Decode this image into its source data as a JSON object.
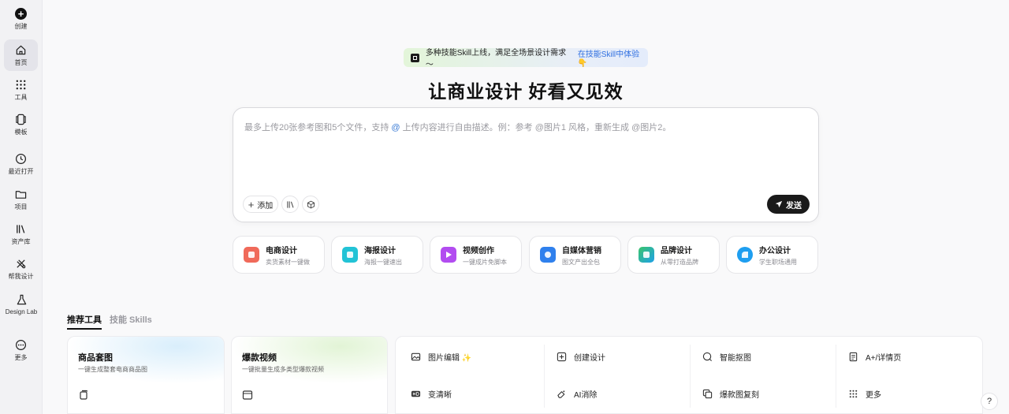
{
  "sidebar": {
    "items": [
      {
        "label": "创建",
        "icon": "create-icon"
      },
      {
        "label": "首页",
        "icon": "home-icon"
      },
      {
        "label": "工具",
        "icon": "grid-icon"
      },
      {
        "label": "模板",
        "icon": "template-icon"
      },
      {
        "label": "最近打开",
        "icon": "clock-icon"
      },
      {
        "label": "项目",
        "icon": "folder-icon"
      },
      {
        "label": "资产库",
        "icon": "library-icon"
      },
      {
        "label": "帮我设计",
        "icon": "design-icon"
      },
      {
        "label": "Design Lab",
        "icon": "flask-icon"
      },
      {
        "label": "更多",
        "icon": "more-icon"
      }
    ]
  },
  "banner": {
    "text": "多种技能Skill上线，满足全场景设计需求～",
    "link": "在技能Skill中体验👇"
  },
  "headline": "让商业设计 好看又见效",
  "prompt": {
    "placeholder_pre": "最多上传20张参考图和5个文件，支持 ",
    "placeholder_at": "@",
    "placeholder_post": " 上传内容进行自由描述。例：参考 @图片1 风格，重新生成 @图片2。",
    "add_label": "添加",
    "send_label": "发送"
  },
  "categories": [
    {
      "title": "电商设计",
      "sub": "卖货素材一键做",
      "color": "#f06a5a"
    },
    {
      "title": "海报设计",
      "sub": "海报一键速出",
      "color": "#22c3d6"
    },
    {
      "title": "视频创作",
      "sub": "一键成片免脚本",
      "color": "#b24cf0"
    },
    {
      "title": "自媒体营销",
      "sub": "图文产出全包",
      "color": "#2f80ed"
    },
    {
      "title": "品牌设计",
      "sub": "从零打造品牌",
      "color": "#3bc46b"
    },
    {
      "title": "办公设计",
      "sub": "学生职场通用",
      "color": "#1e9ef0"
    }
  ],
  "tabs": {
    "recommended": "推荐工具",
    "skills": "技能 Skills"
  },
  "cards": [
    {
      "title": "商品套图",
      "sub": "一键生成整套电商商品图"
    },
    {
      "title": "爆款视频",
      "sub": "一键批量生成多类型爆款视频"
    }
  ],
  "tools": [
    {
      "label": "图片编辑 ✨",
      "icon": "image-icon"
    },
    {
      "label": "创建设计",
      "icon": "plus-square-icon"
    },
    {
      "label": "智能抠图",
      "icon": "cutout-icon"
    },
    {
      "label": "A+/详情页",
      "icon": "page-icon"
    },
    {
      "label": "变清晰",
      "icon": "hd-icon"
    },
    {
      "label": "AI消除",
      "icon": "eraser-icon"
    },
    {
      "label": "爆款图复刻",
      "icon": "copy-icon"
    },
    {
      "label": "更多",
      "icon": "dots-grid-icon"
    }
  ],
  "help": "?"
}
